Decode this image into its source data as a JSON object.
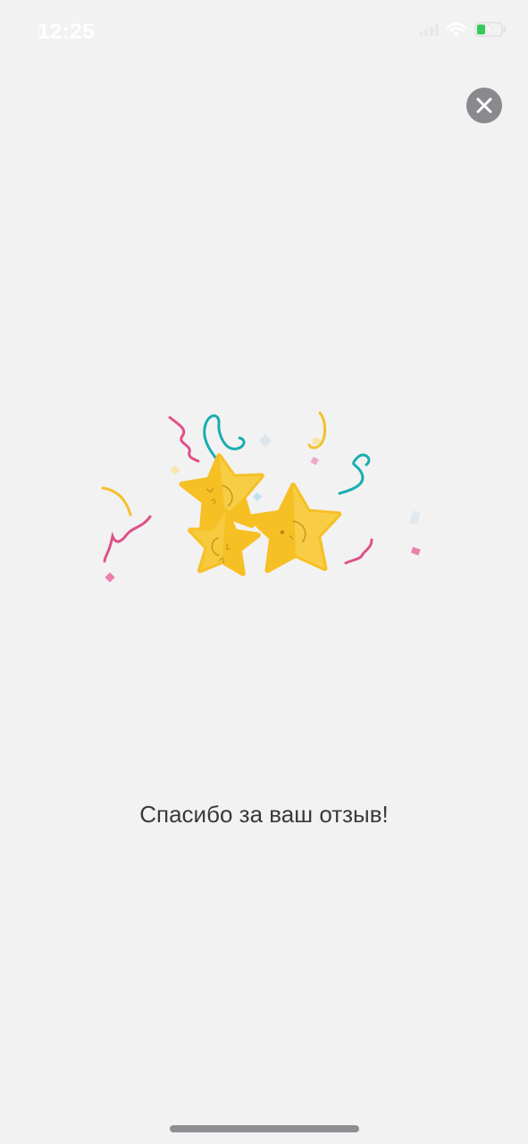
{
  "status_bar": {
    "time": "12:25",
    "wifi_icon": "wifi-icon",
    "battery_icon": "battery-charging-icon",
    "signal_icon": "cellular-signal-icon"
  },
  "close_button": {
    "icon": "close-icon"
  },
  "illustration": {
    "name": "celebrating-stars-confetti",
    "colors": {
      "star": "#f6c024",
      "star_light": "#f9d65e",
      "confetti_pink": "#e0508a",
      "confetti_teal": "#19aeb0",
      "confetti_yellow": "#f3c12d"
    }
  },
  "message": {
    "text": "Спасибо за ваш отзыв!"
  },
  "colors": {
    "background": "#f2f2f2",
    "close_button_bg": "#8a8a8e",
    "text": "#3a3a3c"
  }
}
